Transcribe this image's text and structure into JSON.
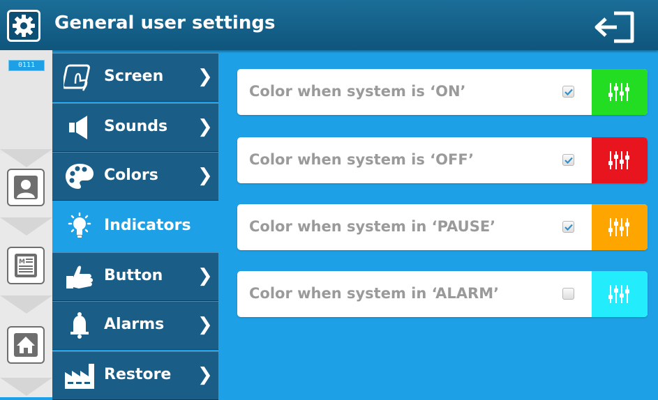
{
  "header": {
    "title": "General user settings"
  },
  "rail": {
    "id_badge": "0111"
  },
  "menu": [
    {
      "label": "Screen",
      "icon": "touch-screen-icon",
      "active": false
    },
    {
      "label": "Sounds",
      "icon": "speaker-icon",
      "active": false
    },
    {
      "label": "Colors",
      "icon": "palette-icon",
      "active": false
    },
    {
      "label": "Indicators",
      "icon": "lightbulb-icon",
      "active": true
    },
    {
      "label": "Button",
      "icon": "hand-press-icon",
      "active": false
    },
    {
      "label": "Alarms",
      "icon": "bell-icon",
      "active": false
    },
    {
      "label": "Restore",
      "icon": "factory-icon",
      "active": false
    }
  ],
  "indicators": [
    {
      "label": "Color when system is ‘ON’",
      "checked": true,
      "color": "#22dd22"
    },
    {
      "label": "Color when system is ‘OFF’",
      "checked": true,
      "color": "#e8141e"
    },
    {
      "label": "Color when system in ‘PAUSE’",
      "checked": true,
      "color": "#ffa500"
    },
    {
      "label": "Color when system in ‘ALARM’",
      "checked": false,
      "color": "#23edfc"
    }
  ],
  "colors": {
    "background": "#1ea0e6",
    "menu": "#1a5d86",
    "header": "#155f88"
  }
}
